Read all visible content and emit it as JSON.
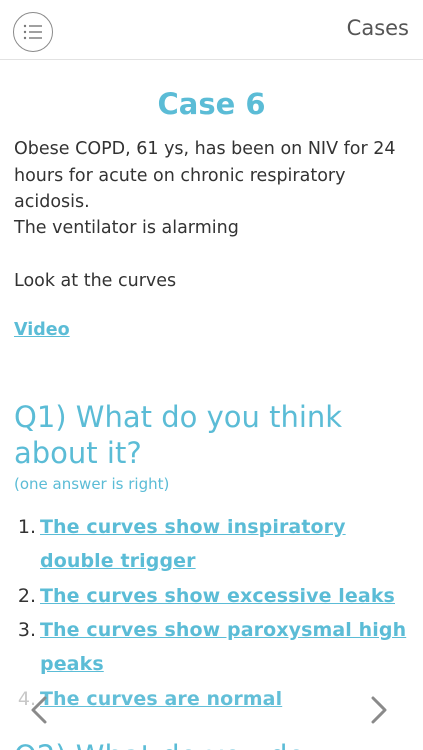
{
  "header": {
    "title": "Cases",
    "menu_icon": "list-icon"
  },
  "case": {
    "title": "Case 6",
    "description": "Obese COPD, 61 ys, has been on NIV for 24 hours for acute on chronic respiratory acidosis.",
    "alarm_text": "The ventilator is alarming",
    "instruction": "Look at the curves",
    "video_label": "Video"
  },
  "question": {
    "text": "Q1) What do you think about it?",
    "hint": "(one answer is right)",
    "answers": [
      {
        "number": "1.",
        "text": "The curves show inspiratory double trigger"
      },
      {
        "number": "2.",
        "text": "The curves show excessive leaks"
      },
      {
        "number": "3.",
        "text": "The curves show paroxysmal high peaks"
      },
      {
        "number": "4.",
        "text": "The curves are normal"
      }
    ]
  },
  "next_question_partial": "Q2) What do you do",
  "nav": {
    "prev_icon": "chevron-left-icon",
    "next_icon": "chevron-right-icon"
  },
  "colors": {
    "accent": "#5bbcd6",
    "text": "#333333",
    "header_text": "#555555"
  }
}
